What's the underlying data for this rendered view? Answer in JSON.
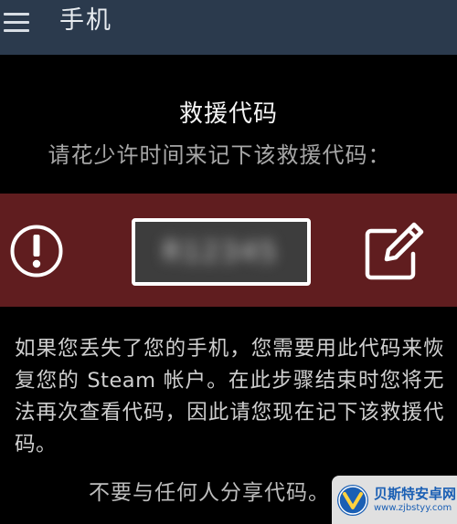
{
  "app_bar": {
    "title": "手机",
    "menu_icon": "hamburger-menu-icon"
  },
  "content": {
    "heading": "救援代码",
    "subheading": "请花少许时间来记下该救援代码：",
    "code_value": "R12345",
    "alert_icon": "exclamation-circle-icon",
    "edit_icon": "edit-pencil-icon",
    "body_text": "如果您丢失了您的手机，您需要用此代码来恢复您的 Steam 帐户。在此步骤结束时您将无法再次查看代码，因此请您现在记下该救援代码。",
    "warning": "不要与任何人分享代码。"
  },
  "watermark": {
    "name": "贝斯特安卓网",
    "url": "www.zjbstyy.com"
  },
  "colors": {
    "app_bar_bg": "#2b3a4d",
    "band_bg": "#601d1f",
    "background": "#000000"
  }
}
